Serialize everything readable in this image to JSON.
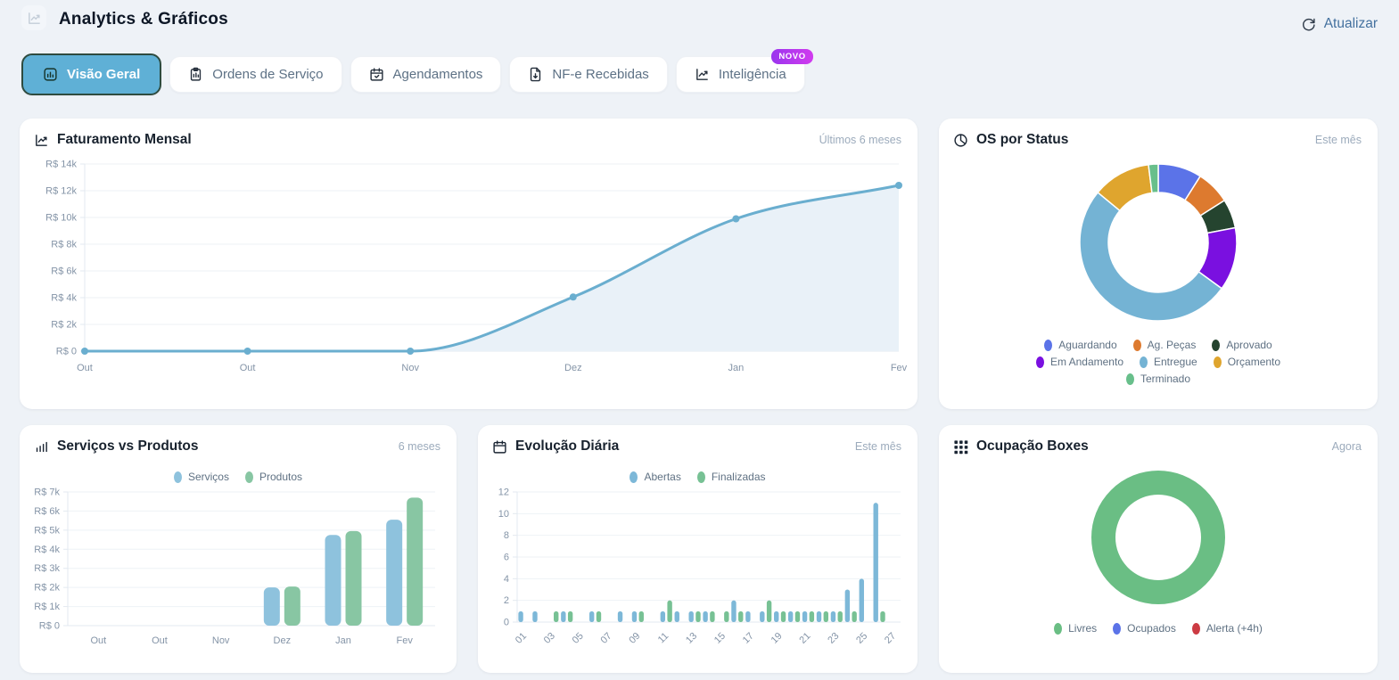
{
  "header": {
    "title": "Analytics & Gráficos",
    "refresh_label": "Atualizar"
  },
  "colors": {
    "tab_active_bg": "#5fb0d6",
    "tab_active_border": "#2e4b3f",
    "refresh_link": "#44719f",
    "badge_gradient_start": "#9a35ee",
    "badge_gradient_end": "#d13bee"
  },
  "tabs": [
    {
      "id": "visao-geral",
      "label": "Visão Geral",
      "icon": "bar-chart",
      "active": true
    },
    {
      "id": "ordens-servico",
      "label": "Ordens de Serviço",
      "icon": "clipboard",
      "active": false
    },
    {
      "id": "agendamentos",
      "label": "Agendamentos",
      "icon": "calendar-check",
      "active": false
    },
    {
      "id": "nfe-recebidas",
      "label": "NF-e Recebidas",
      "icon": "file-down",
      "active": false
    },
    {
      "id": "inteligencia",
      "label": "Inteligência",
      "icon": "trend",
      "active": false,
      "badge": "NOVO"
    }
  ],
  "cards": {
    "faturamento": {
      "title": "Faturamento Mensal",
      "period": "Últimos 6 meses"
    },
    "os_status": {
      "title": "OS por Status",
      "period": "Este mês"
    },
    "servicos_produtos": {
      "title": "Serviços vs Produtos",
      "period": "6 meses"
    },
    "evolucao": {
      "title": "Evolução Diária",
      "period": "Este mês"
    },
    "ocupacao": {
      "title": "Ocupação Boxes",
      "period": "Agora"
    }
  },
  "chart_data": [
    {
      "id": "faturamento_mensal",
      "type": "area",
      "title": "Faturamento Mensal",
      "x": [
        "Out",
        "Out",
        "Nov",
        "Dez",
        "Jan",
        "Fev"
      ],
      "values": [
        0,
        0,
        0,
        4050,
        9900,
        12400
      ],
      "ylim": [
        0,
        14000
      ],
      "ytick_step": 2000,
      "ytick_labels": [
        "R$ 0",
        "R$ 2k",
        "R$ 4k",
        "R$ 6k",
        "R$ 8k",
        "R$ 10k",
        "R$ 12k",
        "R$ 14k"
      ],
      "line_color": "#6aaecf",
      "fill_color": "#e9f1f8",
      "grid": true,
      "legend_position": "none"
    },
    {
      "id": "os_por_status",
      "type": "pie",
      "donut": true,
      "title": "OS por Status",
      "labels": [
        "Aguardando",
        "Ag. Peças",
        "Aprovado",
        "Em Andamento",
        "Entregue",
        "Orçamento",
        "Terminado"
      ],
      "values": [
        9,
        7,
        6,
        13,
        51,
        12,
        2
      ],
      "unit": "percent",
      "colors": [
        "#5b73e8",
        "#dd7a2f",
        "#25442f",
        "#7a10e0",
        "#74b3d4",
        "#dfa52e",
        "#68bf8b"
      ],
      "legend_position": "bottom"
    },
    {
      "id": "servicos_vs_produtos",
      "type": "bar",
      "title": "Serviços vs Produtos",
      "categories": [
        "Out",
        "Out",
        "Nov",
        "Dez",
        "Jan",
        "Fev"
      ],
      "series": [
        {
          "name": "Serviços",
          "values": [
            0,
            0,
            0,
            2000,
            4750,
            5550
          ],
          "color": "#8ec2dd"
        },
        {
          "name": "Produtos",
          "values": [
            0,
            0,
            0,
            2050,
            4950,
            6700
          ],
          "color": "#88c6a3"
        }
      ],
      "ylim": [
        0,
        7000
      ],
      "ytick_step": 1000,
      "ytick_labels": [
        "R$ 0",
        "R$ 1k",
        "R$ 2k",
        "R$ 3k",
        "R$ 4k",
        "R$ 5k",
        "R$ 6k",
        "R$ 7k"
      ],
      "grid": true,
      "legend_position": "top"
    },
    {
      "id": "evolucao_diaria",
      "type": "bar",
      "title": "Evolução Diária",
      "categories": [
        "01",
        "02",
        "03",
        "04",
        "05",
        "06",
        "07",
        "08",
        "09",
        "10",
        "11",
        "12",
        "13",
        "14",
        "15",
        "16",
        "17",
        "18",
        "19",
        "20",
        "21",
        "22",
        "23",
        "24",
        "25",
        "26",
        "27"
      ],
      "series": [
        {
          "name": "Abertas",
          "values": [
            1,
            1,
            0,
            1,
            0,
            1,
            0,
            1,
            1,
            0,
            1,
            1,
            1,
            1,
            0,
            2,
            1,
            1,
            1,
            1,
            1,
            1,
            1,
            3,
            4,
            11,
            0
          ],
          "color": "#7db8d8"
        },
        {
          "name": "Finalizadas",
          "values": [
            0,
            0,
            1,
            1,
            0,
            1,
            0,
            0,
            1,
            0,
            2,
            0,
            1,
            1,
            1,
            1,
            0,
            2,
            1,
            1,
            1,
            1,
            1,
            1,
            0,
            1,
            0
          ],
          "color": "#77c194"
        }
      ],
      "ylim": [
        0,
        12
      ],
      "ytick_step": 2,
      "xtick_every": 2,
      "xtick_rotation": -45,
      "grid": true,
      "legend_position": "top"
    },
    {
      "id": "ocupacao_boxes",
      "type": "pie",
      "donut": true,
      "title": "Ocupação Boxes",
      "labels": [
        "Livres",
        "Ocupados",
        "Alerta (+4h)"
      ],
      "values": [
        100,
        0,
        0
      ],
      "unit": "percent",
      "colors": [
        "#6abe84",
        "#5b73e8",
        "#cc3b43"
      ],
      "legend_position": "bottom"
    }
  ]
}
